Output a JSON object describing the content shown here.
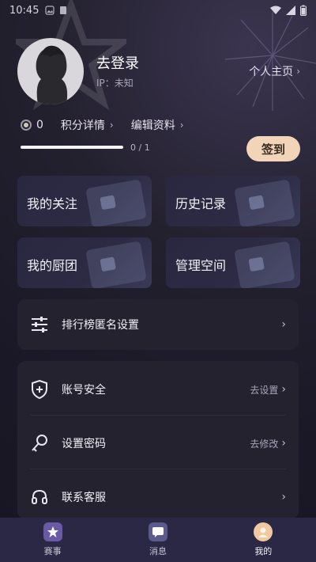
{
  "status": {
    "time": "10:45"
  },
  "profile": {
    "login_text": "去登录",
    "ip_text": "IP：未知",
    "home_link_label": "个人主页"
  },
  "points": {
    "value": "0",
    "details_label": "积分详情",
    "edit_label": "编辑资料",
    "progress_text": "0 / 1",
    "progress_fraction": 1.0,
    "checkin_label": "签到"
  },
  "cards": [
    {
      "label": "我的关注"
    },
    {
      "label": "历史记录"
    },
    {
      "label": "我的厨团"
    },
    {
      "label": "管理空间"
    }
  ],
  "settings": {
    "ranking_anon_label": "排行榜匿名设置"
  },
  "account": {
    "items": [
      {
        "label": "账号安全",
        "action": "去设置"
      },
      {
        "label": "设置密码",
        "action": "去修改"
      },
      {
        "label": "联系客服",
        "action": ""
      }
    ]
  },
  "tabbar": {
    "tabs": [
      {
        "label": "赛事"
      },
      {
        "label": "消息"
      },
      {
        "label": "我的"
      }
    ]
  },
  "colors": {
    "background": "#1c1a28",
    "checkin_button": "#f2d4b8",
    "tabbar": "#2a2844"
  }
}
